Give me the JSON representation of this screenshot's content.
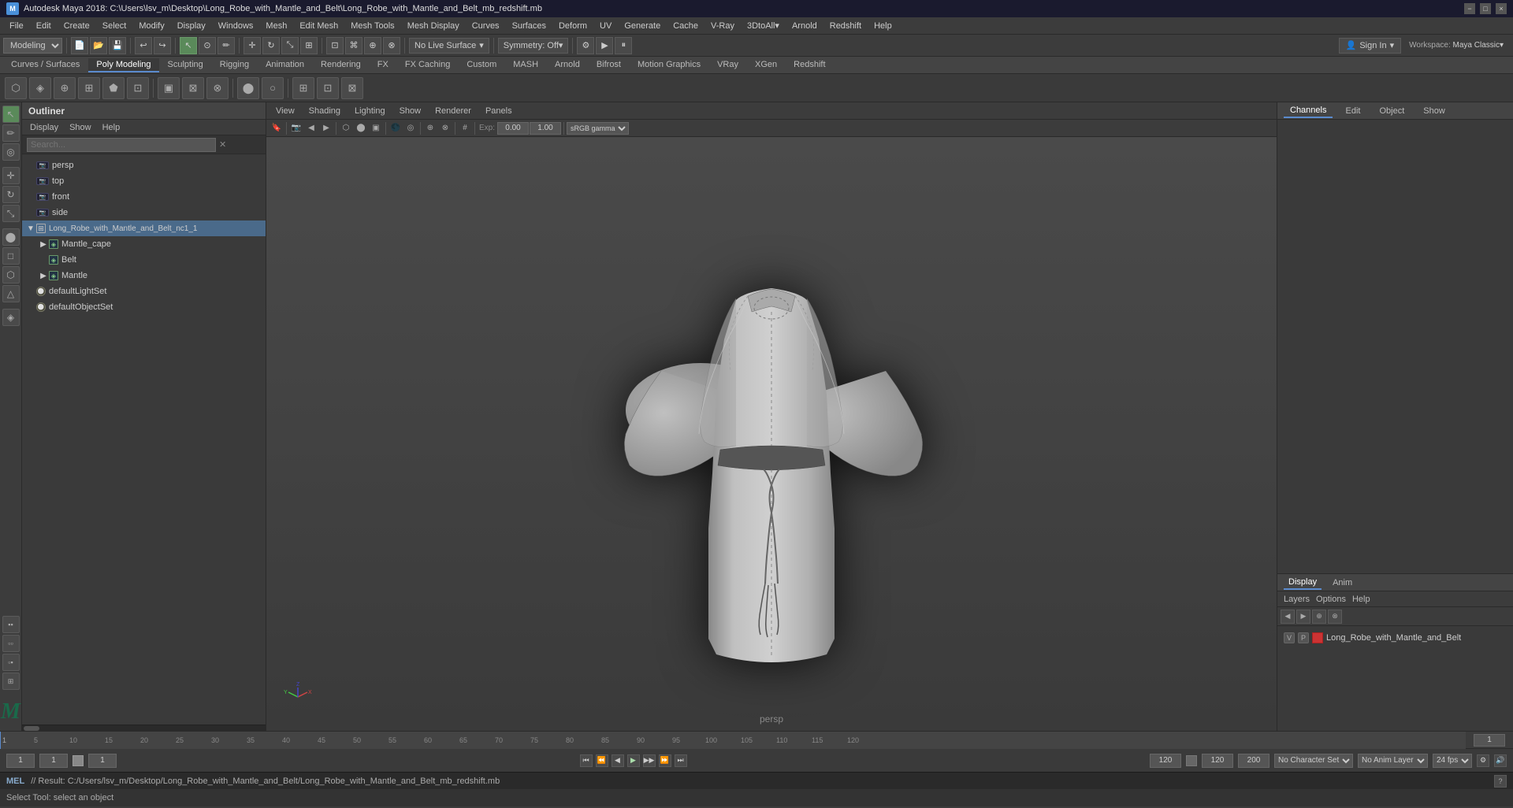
{
  "titlebar": {
    "title": "Autodesk Maya 2018: C:\\Users\\lsv_m\\Desktop\\Long_Robe_with_Mantle_and_Belt\\Long_Robe_with_Mantle_and_Belt_mb_redshift.mb",
    "app_name": "Autodesk Maya 2018",
    "minimize_label": "−",
    "maximize_label": "□",
    "close_label": "×"
  },
  "menubar": {
    "items": [
      "File",
      "Edit",
      "Create",
      "Select",
      "Modify",
      "Display",
      "Windows",
      "Mesh",
      "Edit Mesh",
      "Mesh Tools",
      "Mesh Display",
      "Curves",
      "Surfaces",
      "Deform",
      "UV",
      "Generate",
      "Cache",
      "V-Ray",
      "3DtoAll",
      "Arnold",
      "Redshift",
      "Help"
    ]
  },
  "toolbar1": {
    "workspace_label": "Modeling",
    "no_live_surface": "No Live Surface",
    "symmetry": "Symmetry: Off",
    "sign_in": "Sign In",
    "workspace_right": "Workspace: Maya Classic▾"
  },
  "shelf": {
    "tabs": [
      "Curves / Surfaces",
      "Poly Modeling",
      "Sculpting",
      "Rigging",
      "Animation",
      "Rendering",
      "FX",
      "FX Caching",
      "Custom",
      "MASH",
      "Arnold",
      "Bifrost",
      "Motion Graphics",
      "VRay",
      "XGen",
      "Redshift"
    ],
    "active_tab": "Poly Modeling"
  },
  "outliner": {
    "title": "Outliner",
    "menu_items": [
      "Display",
      "Show",
      "Help"
    ],
    "search_placeholder": "Search...",
    "tree_items": [
      {
        "id": "persp",
        "label": "persp",
        "type": "camera",
        "depth": 0
      },
      {
        "id": "top",
        "label": "top",
        "type": "camera",
        "depth": 0
      },
      {
        "id": "front",
        "label": "front",
        "type": "camera",
        "depth": 0
      },
      {
        "id": "side",
        "label": "side",
        "type": "camera",
        "depth": 0
      },
      {
        "id": "long_robe_group",
        "label": "Long_Robe_with_Mantle_and_Belt_nc1_1",
        "type": "group",
        "depth": 0
      },
      {
        "id": "mantle_cape",
        "label": "Mantle_cape",
        "type": "mesh",
        "depth": 1
      },
      {
        "id": "belt",
        "label": "Belt",
        "type": "mesh",
        "depth": 1
      },
      {
        "id": "mantle",
        "label": "Mantle",
        "type": "mesh",
        "depth": 1
      },
      {
        "id": "defaultLightSet",
        "label": "defaultLightSet",
        "type": "set",
        "depth": 0
      },
      {
        "id": "defaultObjectSet",
        "label": "defaultObjectSet",
        "type": "set",
        "depth": 0
      }
    ]
  },
  "viewport": {
    "menus": [
      "View",
      "Shading",
      "Lighting",
      "Show",
      "Renderer",
      "Panels"
    ],
    "camera_label": "persp",
    "exposure": "0.00",
    "gamma": "1.00",
    "color_space": "sRGB gamma"
  },
  "channels": {
    "tabs": [
      "Channels",
      "Edit",
      "Object",
      "Show"
    ]
  },
  "layers": {
    "tabs": [
      "Display",
      "Anim"
    ],
    "active_tab": "Display",
    "menu_items": [
      "Layers",
      "Options",
      "Help"
    ],
    "layer_name": "Long_Robe_with_Mantle_and_Belt",
    "layer_v": "V",
    "layer_p": "P"
  },
  "timeline": {
    "start": "1",
    "end": "120",
    "range_start": "1",
    "range_end": "200",
    "current_frame": "1",
    "ticks": [
      1,
      5,
      10,
      15,
      20,
      25,
      30,
      35,
      40,
      45,
      50,
      55,
      60,
      65,
      70,
      75,
      80,
      85,
      90,
      95,
      100,
      105,
      110,
      115,
      120
    ]
  },
  "playback": {
    "fps_label": "24 fps",
    "no_character": "No Character Set",
    "no_anim_layer": "No Anim Layer",
    "btn_skip_back": "⏮",
    "btn_prev": "⏪",
    "btn_back": "◀",
    "btn_play": "▶",
    "btn_fwd": "⏩",
    "btn_skip_fwd": "⏭"
  },
  "statusbar": {
    "mel_label": "MEL",
    "result_text": "// Result: C:/Users/lsv_m/Desktop/Long_Robe_with_Mantle_and_Belt/Long_Robe_with_Mantle_and_Belt_mb_redshift.mb",
    "bottom_text": "Select Tool: select an object"
  },
  "tools": {
    "icons": [
      "↖",
      "↔",
      "↕",
      "⟳",
      "⊞",
      "◈",
      "⬡",
      "⬟",
      "⊕",
      "⊗",
      "▣",
      "⊞",
      "⊡",
      "⊠"
    ]
  }
}
